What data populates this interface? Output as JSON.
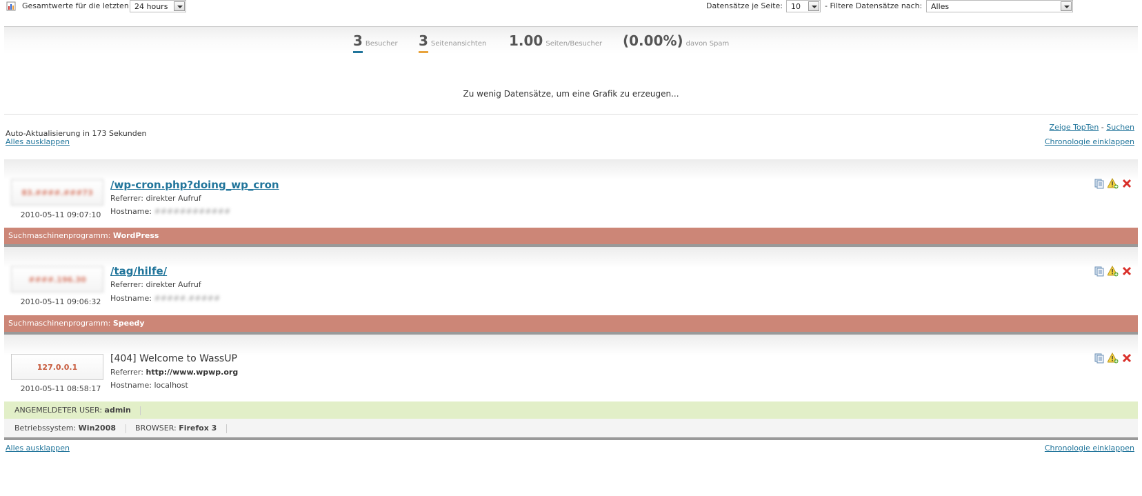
{
  "topbar": {
    "totals_label": "Gesamtwerte für die letzten",
    "period_value": "24 hours",
    "records_label": "Datensätze je Seite:",
    "records_value": "10",
    "filter_label": "- Filtere Datensätze nach:",
    "filter_value": "Alles"
  },
  "stats": {
    "visitors_num": "3",
    "visitors_label": "Besucher",
    "pageviews_num": "3",
    "pageviews_label": "Seitenansichten",
    "ratio_num": "1.00",
    "ratio_label": "Seiten/Besucher",
    "spam_num": "(0.00%)",
    "spam_label": "davon Spam",
    "visitors_color": "#21759b",
    "pageviews_color": "#e8a33c"
  },
  "no_graph_text": "Zu wenig Datensätze, um eine Grafik zu erzeugen...",
  "auto_refresh": "Auto-Aktualisierung in 173 Sekunden",
  "links": {
    "expand_all": "Alles ausklappen",
    "show_topten": "Zeige TopTen",
    "dash": "-",
    "search": "Suchen",
    "collapse_chrono": "Chronologie einklappen"
  },
  "entries": [
    {
      "ip": "83.####.###73",
      "date": "2010-05-11 09:07:10",
      "url": "/wp-cron.php?doing_wp_cron",
      "referrer_label": "Referrer:",
      "referrer": "direkter Aufruf",
      "hostname_label": "Hostname:",
      "hostname": "############",
      "bar_label": "Suchmaschinenprogramm:",
      "bar_value": "WordPress"
    },
    {
      "ip": "####.196.30",
      "date": "2010-05-11 09:06:32",
      "url": "/tag/hilfe/",
      "referrer_label": "Referrer:",
      "referrer": "direkter Aufruf",
      "hostname_label": "Hostname:",
      "hostname": "#####.#####",
      "bar_label": "Suchmaschinenprogramm:",
      "bar_value": "Speedy"
    },
    {
      "ip": "127.0.0.1",
      "date": "2010-05-11 08:58:17",
      "url": "[404] Welcome to WassUP",
      "referrer_label": "Referrer:",
      "referrer": "http://www.wpwp.org",
      "hostname_label": "Hostname:",
      "hostname": "localhost",
      "user_label": "ANGEMELDETER USER:",
      "user_value": "admin",
      "os_label": "Betriebssystem:",
      "os_value": "Win2008",
      "browser_label": "BROWSER:",
      "browser_value": "Firefox 3"
    }
  ],
  "icons": {
    "details": "details-icon",
    "spam": "mark-spam-icon",
    "delete": "delete-icon"
  }
}
